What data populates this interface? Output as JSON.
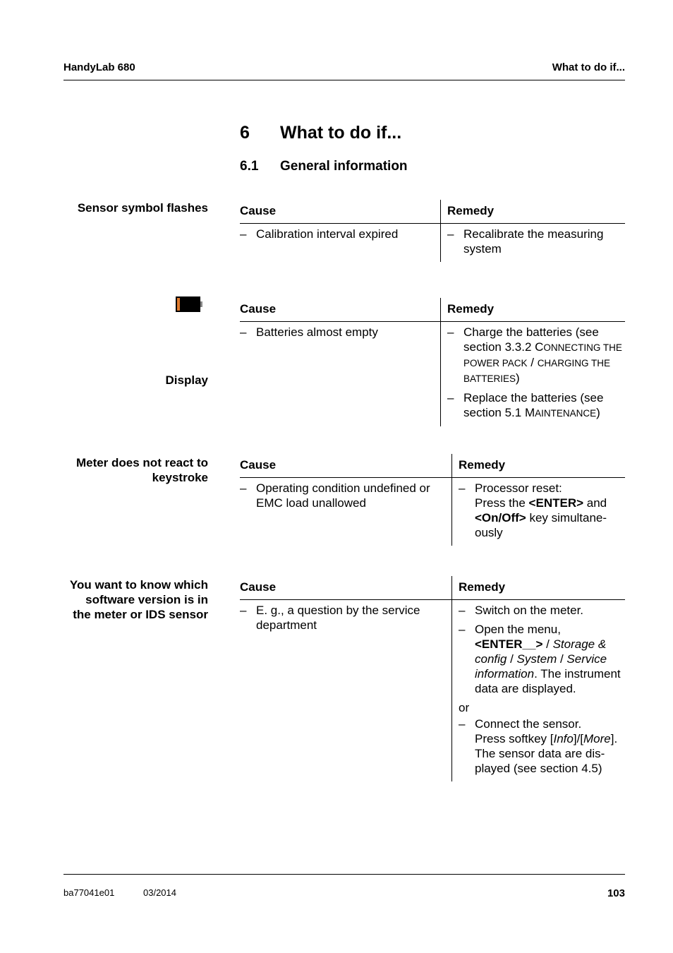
{
  "header": {
    "left": "HandyLab 680",
    "right": "What to do if..."
  },
  "chapter": {
    "number": "6",
    "title": "What to do if..."
  },
  "section": {
    "number": "6.1",
    "title": "General information"
  },
  "table_headers": {
    "cause": "Cause",
    "remedy": "Remedy"
  },
  "dash": "–",
  "blocks": [
    {
      "side_label": "Sensor symbol flashes",
      "cause": "Calibration interval expired",
      "remedy": [
        "Recalibrate the measuring system"
      ]
    },
    {
      "side_label": "Display",
      "icon": "battery-low-icon",
      "cause": "Batteries almost empty",
      "remedy": {
        "r1_pre": "Charge the batteries (see section 3.3.2 ",
        "r1_c": "C",
        "r1_sc": "ONNECTING THE POWER PACK",
        "r1_mid": " / ",
        "r1_sc2": "CHARGING THE BATTERIES",
        "r1_post": ")",
        "r2_pre": "Replace the batteries (see section 5.1 ",
        "r2_c": "M",
        "r2_sc": "AINTENANCE",
        "r2_post": ")"
      }
    },
    {
      "side_label_line1": "Meter does not react to",
      "side_label_line2": "keystroke",
      "cause": "Operating condition undefined or EMC load unallowed",
      "remedy": {
        "line1": "Processor reset:",
        "press": "Press the ",
        "key1": "<ENTER>",
        "and": " and ",
        "key2": "<On/Off>",
        "tail": " key simultane-ously"
      }
    },
    {
      "side_label_line1": "You want to know which",
      "side_label_line2": "software version is in",
      "side_label_line3": "the meter or IDS sensor",
      "cause": "E. g., a question by the service department",
      "remedy": {
        "r1": "Switch on the meter.",
        "r2_pre": "Open the menu, ",
        "r2_key": "<ENTER__>",
        "r2_sep1": " / ",
        "r2_m1": "Storage & config",
        "r2_sep2": " / ",
        "r2_m2": "System",
        "r2_sep3": " / ",
        "r2_m3": "Service information",
        "r2_post": ". The instrument data are displayed.",
        "or": "or",
        "r3_line1": "Connect the sensor.",
        "r3_pre": "Press softkey [",
        "r3_k1": "Info",
        "r3_mid": "]/[",
        "r3_k2": "More",
        "r3_post": "]. The sensor data are dis-played (see section 4.5)"
      }
    }
  ],
  "footer": {
    "doc_id": "ba77041e01",
    "date": "03/2014",
    "page": "103"
  },
  "colors": {
    "battery_fill": "#e07b2e"
  }
}
